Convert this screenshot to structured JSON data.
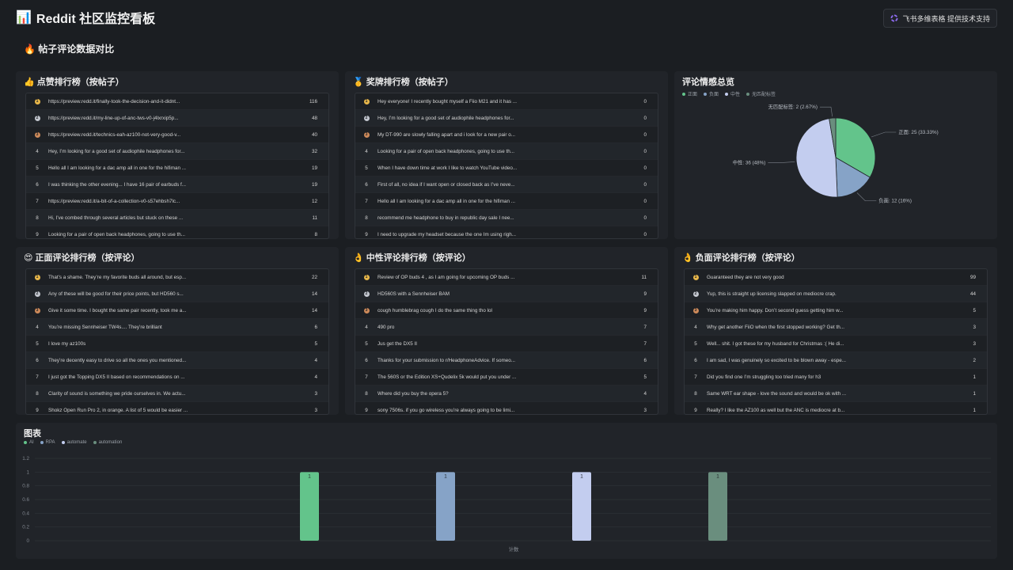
{
  "header": {
    "emoji": "📊",
    "title": "Reddit 社区监控看板",
    "support_text": "飞书多维表格 提供技术支持"
  },
  "section": {
    "emoji": "🔥",
    "title": "帖子评论数据对比"
  },
  "colors": {
    "positive": "#63c48b",
    "negative": "#86a3c7",
    "neutral": "#c3cdef",
    "unmatched": "#6a8e7e"
  },
  "cards": {
    "likes": {
      "emoji": "👍",
      "title": "点赞排行榜（按帖子）",
      "rows": [
        {
          "rank": "1",
          "text": "https://preview.redd.it/finally-took-the-decision-and-it-didnt...",
          "value": "116"
        },
        {
          "rank": "2",
          "text": "https://preview.redd.it/my-line-up-of-anc-tws-v0-j4lxrxip5p...",
          "value": "48"
        },
        {
          "rank": "3",
          "text": "https://preview.redd.it/technics-eah-az100-not-very-good-v...",
          "value": "40"
        },
        {
          "rank": "4",
          "text": "Hey, I’m looking for a good set of audiophile headphones for...",
          "value": "32"
        },
        {
          "rank": "5",
          "text": "Hello all I am looking for a dac amp all in one for the hifiman ...",
          "value": "19"
        },
        {
          "rank": "6",
          "text": "I was thinking the other evening... I have 16 pair of earbuds f...",
          "value": "19"
        },
        {
          "rank": "7",
          "text": "https://preview.redd.it/a-bit-of-a-collection-v0-s57ehbsh7lc...",
          "value": "12"
        },
        {
          "rank": "8",
          "text": "Hi, I’ve combed through several articles but stuck on these ...",
          "value": "11"
        },
        {
          "rank": "9",
          "text": "Looking for a pair of open back headphones, going to use th...",
          "value": "8"
        }
      ]
    },
    "awards": {
      "emoji": "🥇",
      "title": "奖牌排行榜（按帖子）",
      "rows": [
        {
          "rank": "1",
          "text": "Hey everyone! I recently bought myself a Fiio M21 and it has ...",
          "value": "0"
        },
        {
          "rank": "2",
          "text": "Hey, I’m looking for a good set of audiophile headphones for...",
          "value": "0"
        },
        {
          "rank": "3",
          "text": "My DT-990 are slowly falling apart and i look for a new pair o...",
          "value": "0"
        },
        {
          "rank": "4",
          "text": "Looking for a pair of open back headphones, going to use th...",
          "value": "0"
        },
        {
          "rank": "5",
          "text": "When I have down time at work I like to watch YouTube video...",
          "value": "0"
        },
        {
          "rank": "6",
          "text": "First of all, no idea if I want open or closed back as I’ve neve...",
          "value": "0"
        },
        {
          "rank": "7",
          "text": "Hello all I am looking for a dac amp all in one for the hifiman ...",
          "value": "0"
        },
        {
          "rank": "8",
          "text": "recommend me headphone to buy in republic day sale I nee...",
          "value": "0"
        },
        {
          "rank": "9",
          "text": "I need to upgrade my headset because the one Im using righ...",
          "value": "0"
        }
      ]
    },
    "positive": {
      "emoji": "😍",
      "title": "正面评论排行榜（按评论）",
      "rows": [
        {
          "rank": "1",
          "text": "That’s a shame. They’re my favorite buds all around, but esp...",
          "value": "22"
        },
        {
          "rank": "2",
          "text": "Any of these will be good for their price points, but HD560 s...",
          "value": "14"
        },
        {
          "rank": "3",
          "text": "Give it some time. I bought the same pair recently, took me a...",
          "value": "14"
        },
        {
          "rank": "4",
          "text": "You’re missing Sennheiser TW4s.... They’re brilliant",
          "value": "6"
        },
        {
          "rank": "5",
          "text": "I love my az100s",
          "value": "5"
        },
        {
          "rank": "6",
          "text": "They’re decently easy to drive so all the ones you mentioned...",
          "value": "4"
        },
        {
          "rank": "7",
          "text": "I just got the Topping DX5 II based on recommendations on ...",
          "value": "4"
        },
        {
          "rank": "8",
          "text": "Clarity of sound is something we pride ourselves in. We actu...",
          "value": "3"
        },
        {
          "rank": "9",
          "text": "Shokz Open Run Pro 2, in orange. A list of 5 would be easier ...",
          "value": "3"
        }
      ]
    },
    "neutral": {
      "emoji": "👌",
      "title": "中性评论排行榜（按评论）",
      "rows": [
        {
          "rank": "1",
          "text": "Review of OP buds 4 , as I am going for upcoming OP buds ...",
          "value": "11"
        },
        {
          "rank": "2",
          "text": "HD560S with a Sennheiser BAM",
          "value": "9"
        },
        {
          "rank": "3",
          "text": "cough humblebrag cough I do the same thing tho lol",
          "value": "9"
        },
        {
          "rank": "4",
          "text": "490 pro",
          "value": "7"
        },
        {
          "rank": "5",
          "text": "Jus get the DX5 II",
          "value": "7"
        },
        {
          "rank": "6",
          "text": "Thanks for your submission to r/HeadphoneAdvice. If someo...",
          "value": "6"
        },
        {
          "rank": "7",
          "text": "The 560S or the Edition XS+Qudelix 5k would put you under ...",
          "value": "5"
        },
        {
          "rank": "8",
          "text": "Where did you buy the opera 5?",
          "value": "4"
        },
        {
          "rank": "9",
          "text": "sony 7506s. if you go wireless you’re always going to be limi...",
          "value": "3"
        }
      ]
    },
    "negative": {
      "emoji": "👌",
      "title": "负面评论排行榜（按评论）",
      "rows": [
        {
          "rank": "1",
          "text": "Guaranteed they are not very good",
          "value": "99"
        },
        {
          "rank": "2",
          "text": "Yup, this is straight up licensing slapped on mediocre crap.",
          "value": "44"
        },
        {
          "rank": "3",
          "text": "You’re making him happy. Don’t second guess getting him w...",
          "value": "5"
        },
        {
          "rank": "4",
          "text": "Why get another FiiO when the first stopped working? Get th...",
          "value": "3"
        },
        {
          "rank": "5",
          "text": "Well... shit. I got these for my husband for Christmas :( He di...",
          "value": "3"
        },
        {
          "rank": "6",
          "text": "I am sad, I was genuinely so excited to be blown away - espe...",
          "value": "2"
        },
        {
          "rank": "7",
          "text": "Did you find one I’m struggling too tried many for h3",
          "value": "1"
        },
        {
          "rank": "8",
          "text": "Same WRT ear shape - love the sound and would be ok with ...",
          "value": "1"
        },
        {
          "rank": "9",
          "text": "Really? I like the AZ100 as well but the ANC is mediocre at b...",
          "value": "1"
        }
      ]
    }
  },
  "chart_data": [
    {
      "type": "pie",
      "title": "评论情感总览",
      "legend": [
        "正面",
        "负面",
        "中性",
        "无匹配标签"
      ],
      "slices": [
        {
          "name": "正面",
          "value": 25,
          "label": "正面: 25 (33.33%)",
          "color": "#63c48b"
        },
        {
          "name": "负面",
          "value": 12,
          "label": "负面: 12 (16%)",
          "color": "#86a3c7"
        },
        {
          "name": "中性",
          "value": 36,
          "label": "中性: 36 (48%)",
          "color": "#c3cdef"
        },
        {
          "name": "无匹配标签",
          "value": 2,
          "label": "无匹配标签: 2 (2.67%)",
          "color": "#6a8e7e"
        }
      ]
    },
    {
      "type": "bar",
      "title": "图表",
      "xlabel": "计数",
      "ylim": [
        0,
        1.2
      ],
      "yticks": [
        "0",
        "0.2",
        "0.4",
        "0.6",
        "0.8",
        "1",
        "1.2"
      ],
      "series": [
        {
          "name": "AI",
          "values": [
            1
          ],
          "color": "#63c48b",
          "label": "1"
        },
        {
          "name": "RPA",
          "values": [
            1
          ],
          "color": "#86a3c7",
          "label": "1"
        },
        {
          "name": "automate",
          "values": [
            1
          ],
          "color": "#c3cdef",
          "label": "1"
        },
        {
          "name": "automation",
          "values": [
            1
          ],
          "color": "#6a8e7e",
          "label": "1"
        }
      ]
    }
  ]
}
